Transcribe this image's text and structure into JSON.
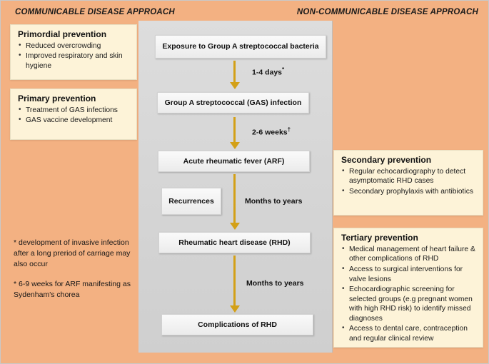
{
  "headers": {
    "left": "COMMUNICABLE DISEASE APPROACH",
    "right": "NON-COMMUNICABLE DISEASE APPROACH"
  },
  "flow": {
    "boxes": [
      {
        "label": "Exposure to Group A streptococcal bacteria"
      },
      {
        "label": "Group A streptococcal (GAS) infection"
      },
      {
        "label": "Acute rheumatic fever (ARF)"
      },
      {
        "label": "Rheumatic  heart disease (RHD)"
      },
      {
        "label": "Complications of RHD"
      }
    ],
    "side_box": {
      "label": "Recurrences"
    },
    "arrow_labels": [
      {
        "text": "1-4 days",
        "marker": "*"
      },
      {
        "text": "2-6 weeks",
        "marker": "†"
      },
      {
        "text": "Months to years",
        "marker": ""
      },
      {
        "text": "Months to years",
        "marker": ""
      }
    ]
  },
  "left_panels": [
    {
      "title": "Primordial prevention",
      "items": [
        "Reduced overcrowding",
        "Improved respiratory and skin hygiene"
      ]
    },
    {
      "title": "Primary prevention",
      "items": [
        "Treatment of GAS infections",
        "GAS vaccine development"
      ]
    }
  ],
  "right_panels": [
    {
      "title": "Secondary prevention",
      "items": [
        "Regular echocardiography to detect asymptomatic RHD cases",
        "Secondary prophylaxis with antibiotics"
      ]
    },
    {
      "title": "Tertiary prevention",
      "items": [
        "Medical management of heart failure & other complications of RHD",
        "Access to surgical interventions for valve lesions",
        "Echocardiographic screening for selected groups (e.g pregnant women with high RHD risk) to identify missed diagnoses",
        "Access to dental care, contraception and regular clinical review"
      ]
    }
  ],
  "footnotes": [
    "* development of invasive infection after a long preriod of carriage may also occur",
    "* 6-9 weeks for ARF manifesting as Sydenham's chorea"
  ],
  "colors": {
    "background_orange": "#F3B182",
    "panel_cream": "#FDF3D8",
    "center_gray": "#D6D6D6",
    "arrow_gold": "#D3A017"
  }
}
